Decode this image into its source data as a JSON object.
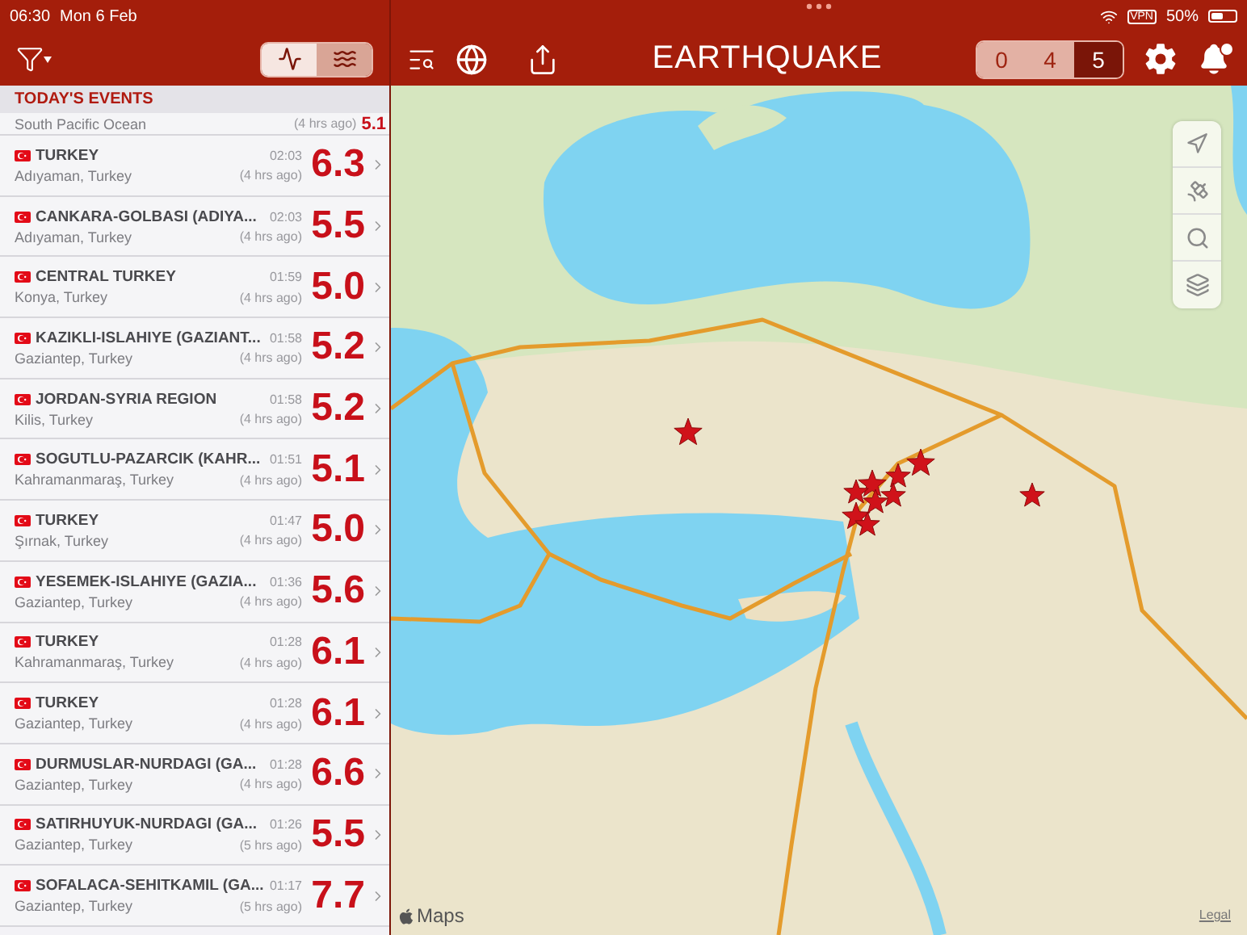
{
  "status_bar": {
    "time": "06:30",
    "date": "Mon 6 Feb",
    "vpn": "VPN",
    "battery": "50%"
  },
  "list_toolbar": {
    "view_modes": [
      {
        "kind": "waveform",
        "selected": true
      },
      {
        "kind": "waves",
        "selected": false
      }
    ]
  },
  "map_toolbar": {
    "title": "EARTHQUAKE",
    "counters": [
      {
        "label": "0",
        "selected": false
      },
      {
        "label": "4",
        "selected": false
      },
      {
        "label": "5",
        "selected": true
      }
    ]
  },
  "events": {
    "header": "TODAY'S EVENTS",
    "rows": [
      {
        "location": "South Pacific Ocean",
        "ago": "(4 hrs ago)",
        "magnitude": "5.1"
      },
      {
        "title": "TURKEY",
        "time": "02:03",
        "location": "Adıyaman, Turkey",
        "ago": "(4 hrs ago)",
        "magnitude": "6.3"
      },
      {
        "title": "CANKARA-GOLBASI (ADIYA...",
        "time": "02:03",
        "location": "Adıyaman, Turkey",
        "ago": "(4 hrs ago)",
        "magnitude": "5.5"
      },
      {
        "title": "CENTRAL TURKEY",
        "time": "01:59",
        "location": "Konya, Turkey",
        "ago": "(4 hrs ago)",
        "magnitude": "5.0"
      },
      {
        "title": "KAZIKLI-ISLAHIYE (GAZIANT...",
        "time": "01:58",
        "location": "Gaziantep, Turkey",
        "ago": "(4 hrs ago)",
        "magnitude": "5.2"
      },
      {
        "title": "JORDAN-SYRIA REGION",
        "time": "01:58",
        "location": "Kilis, Turkey",
        "ago": "(4 hrs ago)",
        "magnitude": "5.2"
      },
      {
        "title": "SOGUTLU-PAZARCIK (KAHR...",
        "time": "01:51",
        "location": "Kahramanmaraş, Turkey",
        "ago": "(4 hrs ago)",
        "magnitude": "5.1"
      },
      {
        "title": "TURKEY",
        "time": "01:47",
        "location": "Şırnak, Turkey",
        "ago": "(4 hrs ago)",
        "magnitude": "5.0"
      },
      {
        "title": "YESEMEK-ISLAHIYE (GAZIA...",
        "time": "01:36",
        "location": "Gaziantep, Turkey",
        "ago": "(4 hrs ago)",
        "magnitude": "5.6"
      },
      {
        "title": "TURKEY",
        "time": "01:28",
        "location": "Kahramanmaraş, Turkey",
        "ago": "(4 hrs ago)",
        "magnitude": "6.1"
      },
      {
        "title": "TURKEY",
        "time": "01:28",
        "location": "Gaziantep, Turkey",
        "ago": "(4 hrs ago)",
        "magnitude": "6.1"
      },
      {
        "title": "DURMUSLAR-NURDAGI (GA...",
        "time": "01:28",
        "location": "Gaziantep, Turkey",
        "ago": "(4 hrs ago)",
        "magnitude": "6.6"
      },
      {
        "title": "SATIRHUYUK-NURDAGI (GA...",
        "time": "01:26",
        "location": "Gaziantep, Turkey",
        "ago": "(5 hrs ago)",
        "magnitude": "5.5"
      },
      {
        "title": "SOFALACA-SEHITKAMIL (GA...",
        "time": "01:17",
        "location": "Gaziantep, Turkey",
        "ago": "(5 hrs ago)",
        "magnitude": "7.7"
      }
    ]
  },
  "map": {
    "attribution": "Maps",
    "legal": "Legal"
  }
}
